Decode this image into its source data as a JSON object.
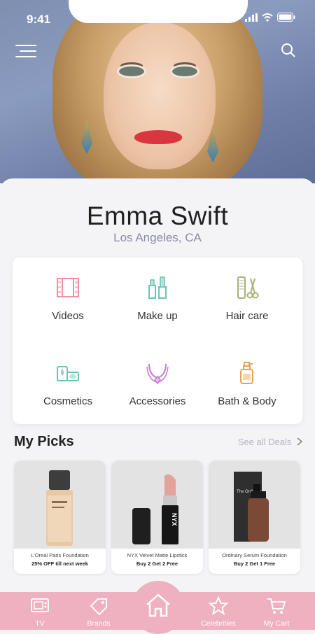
{
  "status_bar": {
    "time": "9:41"
  },
  "profile": {
    "name": "Emma Swift",
    "location": "Los Angeles, CA"
  },
  "categories": [
    {
      "label": "Videos",
      "icon": "film-icon"
    },
    {
      "label": "Make up",
      "icon": "makeup-icon"
    },
    {
      "label": "Hair care",
      "icon": "comb-scissors-icon"
    },
    {
      "label": "Cosmetics",
      "icon": "cosmetics-icon"
    },
    {
      "label": "Accessories",
      "icon": "necklace-icon"
    },
    {
      "label": "Bath & Body",
      "icon": "lotion-bottle-icon"
    }
  ],
  "picks": {
    "title": "My Picks",
    "see_all": "See all Deals",
    "items": [
      {
        "name": "L'Oreal Paris Foundation",
        "deal": "25% OFF till next week"
      },
      {
        "name": "NYX Velvet Matte Lipstick",
        "deal": "Buy 2 Get 2 Free"
      },
      {
        "name": "Ordinary Serum Foundation",
        "deal": "Buy 2 Get 1 Free"
      }
    ]
  },
  "nav": [
    {
      "label": "TV",
      "icon": "tv-icon"
    },
    {
      "label": "Brands",
      "icon": "tag-icon"
    },
    {
      "label": "",
      "icon": "home-icon"
    },
    {
      "label": "Celebrities",
      "icon": "star-icon"
    },
    {
      "label": "My Cart",
      "icon": "cart-icon"
    }
  ],
  "colors": {
    "accent_pink": "#efb0c0",
    "icon_pink": "#f08fa5",
    "icon_teal": "#6cc4b4",
    "icon_purple": "#c77ad6",
    "icon_orange": "#e3a25a",
    "icon_olive": "#a8b07a"
  },
  "product_labels": {
    "nyx": "NYX",
    "the_ordinary": "The Ordinary."
  }
}
